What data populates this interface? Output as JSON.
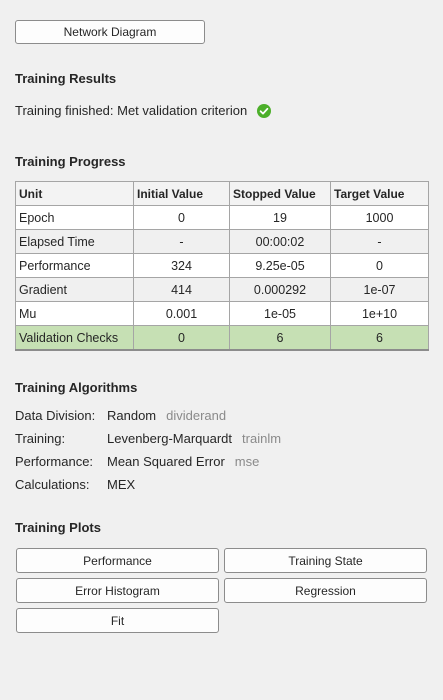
{
  "buttons": {
    "network_diagram": "Network Diagram"
  },
  "results": {
    "title": "Training Results",
    "status": "Training finished: Met validation criterion",
    "status_icon": "check-circle-icon",
    "status_color": "#4caf2a"
  },
  "progress": {
    "title": "Training Progress",
    "headers": [
      "Unit",
      "Initial Value",
      "Stopped Value",
      "Target Value"
    ],
    "rows": [
      [
        "Epoch",
        "0",
        "19",
        "1000"
      ],
      [
        "Elapsed Time",
        "-",
        "00:00:02",
        "-"
      ],
      [
        "Performance",
        "324",
        "9.25e-05",
        "0"
      ],
      [
        "Gradient",
        "414",
        "0.000292",
        "1e-07"
      ],
      [
        "Mu",
        "0.001",
        "1e-05",
        "1e+10"
      ],
      [
        "Validation Checks",
        "0",
        "6",
        "6"
      ]
    ],
    "highlight_color": "#c6e0b4"
  },
  "algorithms": {
    "title": "Training Algorithms",
    "items": [
      {
        "label": "Data Division:",
        "value": "Random",
        "fn": "dividerand"
      },
      {
        "label": "Training:",
        "value": "Levenberg-Marquardt",
        "fn": "trainlm"
      },
      {
        "label": "Performance:",
        "value": "Mean Squared Error",
        "fn": "mse"
      },
      {
        "label": "Calculations:",
        "value": "MEX",
        "fn": ""
      }
    ]
  },
  "plots": {
    "title": "Training Plots",
    "buttons": [
      "Performance",
      "Training State",
      "Error Histogram",
      "Regression",
      "Fit"
    ]
  }
}
